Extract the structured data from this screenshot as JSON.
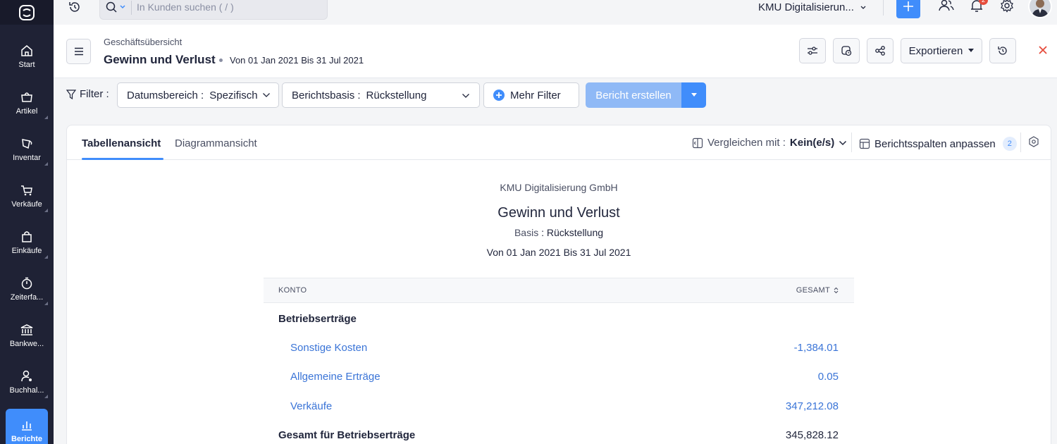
{
  "app": {
    "logo": "books-logo-icon"
  },
  "sidebar": {
    "items": [
      {
        "label": "Start",
        "icon": "home-icon",
        "active": false
      },
      {
        "label": "Artikel",
        "icon": "basket-icon",
        "active": false
      },
      {
        "label": "Inventar",
        "icon": "inventory-icon",
        "active": false
      },
      {
        "label": "Verkäufe",
        "icon": "cart-icon",
        "active": false
      },
      {
        "label": "Einkäufe",
        "icon": "bag-icon",
        "active": false
      },
      {
        "label": "Zeiterfa...",
        "icon": "stopwatch-icon",
        "active": false
      },
      {
        "label": "Bankwe...",
        "icon": "bank-icon",
        "active": false
      },
      {
        "label": "Buchhal...",
        "icon": "accountant-icon",
        "active": false
      },
      {
        "label": "Berichte",
        "icon": "chart-icon",
        "active": true
      }
    ]
  },
  "topbar": {
    "search_placeholder": "In Kunden suchen ( / )",
    "org_name": "KMU Digitalisierun...",
    "notification_count": "2"
  },
  "report_header": {
    "breadcrumb": "Geschäftsübersicht",
    "title": "Gewinn und Verlust",
    "date_range": "Von 01 Jan 2021 Bis 31 Jul 2021",
    "export_label": "Exportieren"
  },
  "filters": {
    "label": "Filter :",
    "date_key": "Datumsbereich :",
    "date_value": "Spezifisch",
    "basis_key": "Berichtsbasis :",
    "basis_value": "Rückstellung",
    "more_label": "Mehr Filter",
    "run_label": "Bericht erstellen"
  },
  "tabs": {
    "table": "Tabellenansicht",
    "chart": "Diagrammansicht",
    "compare_label": "Vergleichen mit :",
    "compare_value": "Kein(e/s)",
    "columns_label": "Berichtsspalten anpassen",
    "columns_count": "2"
  },
  "report": {
    "org": "KMU Digitalisierung GmbH",
    "title": "Gewinn und Verlust",
    "basis_label": "Basis",
    "basis_sep": " : ",
    "basis_value": "Rückstellung",
    "range": "Von 01 Jan 2021 Bis 31 Jul 2021",
    "col_account": "KONTO",
    "col_total": "GESAMT",
    "section": "Betriebserträge",
    "rows": [
      {
        "account": "Sonstige Kosten",
        "total": "-1,384.01"
      },
      {
        "account": "Allgemeine Erträge",
        "total": "0.05"
      },
      {
        "account": "Verkäufe",
        "total": "347,212.08"
      }
    ],
    "total_label": "Gesamt für Betriebserträge",
    "total_value": "345,828.12"
  },
  "colors": {
    "accent": "#408dfb",
    "sidebar": "#1f2235",
    "link": "#3a74d7"
  }
}
